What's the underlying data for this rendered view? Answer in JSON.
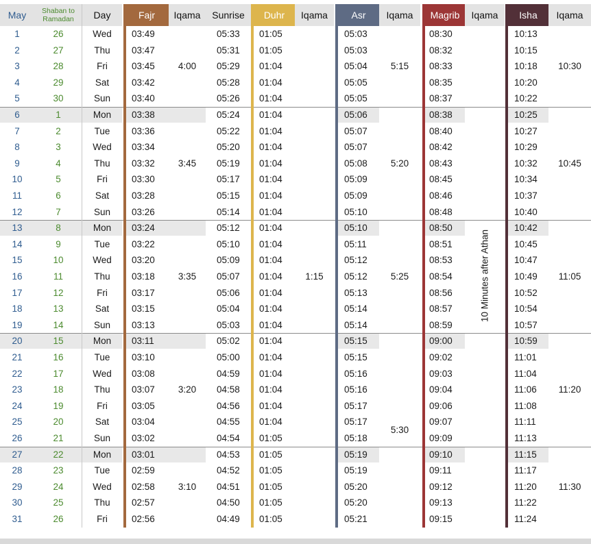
{
  "headers": {
    "date": "May",
    "hijri_line1": "Shaban to",
    "hijri_line2": "Ramadan",
    "day": "Day",
    "fajr": "Fajr",
    "fajr_iqama": "Iqama",
    "sunrise": "Sunrise",
    "duhr": "Duhr",
    "duhr_iqama": "Iqama",
    "asr": "Asr",
    "asr_iqama": "Iqama",
    "magrib": "Magrib",
    "magrib_iqama": "Iqama",
    "isha": "Isha",
    "isha_iqama": "Iqama"
  },
  "colors": {
    "fajr": "#a3693e",
    "duhr": "#ddb54d",
    "asr": "#5e6b84",
    "magrib": "#9c3636",
    "isha": "#523038",
    "date_text": "#2f5c8f",
    "hijri_text": "#4b8a2e",
    "week_shade": "#e8e8e8"
  },
  "rows": [
    {
      "date": "1",
      "hijri": "26",
      "day": "Wed",
      "fajr": "03:49",
      "sunrise": "05:33",
      "duhr": "01:05",
      "asr": "05:03",
      "magrib": "08:30",
      "isha": "10:13"
    },
    {
      "date": "2",
      "hijri": "27",
      "day": "Thu",
      "fajr": "03:47",
      "sunrise": "05:31",
      "duhr": "01:05",
      "asr": "05:03",
      "magrib": "08:32",
      "isha": "10:15"
    },
    {
      "date": "3",
      "hijri": "28",
      "day": "Fri",
      "fajr": "03:45",
      "sunrise": "05:29",
      "duhr": "01:04",
      "asr": "05:04",
      "magrib": "08:33",
      "isha": "10:18"
    },
    {
      "date": "4",
      "hijri": "29",
      "day": "Sat",
      "fajr": "03:42",
      "sunrise": "05:28",
      "duhr": "01:04",
      "asr": "05:05",
      "magrib": "08:35",
      "isha": "10:20"
    },
    {
      "date": "5",
      "hijri": "30",
      "day": "Sun",
      "fajr": "03:40",
      "sunrise": "05:26",
      "duhr": "01:04",
      "asr": "05:05",
      "magrib": "08:37",
      "isha": "10:22"
    },
    {
      "date": "6",
      "hijri": "1",
      "day": "Mon",
      "fajr": "03:38",
      "sunrise": "05:24",
      "duhr": "01:04",
      "asr": "05:06",
      "magrib": "08:38",
      "isha": "10:25"
    },
    {
      "date": "7",
      "hijri": "2",
      "day": "Tue",
      "fajr": "03:36",
      "sunrise": "05:22",
      "duhr": "01:04",
      "asr": "05:07",
      "magrib": "08:40",
      "isha": "10:27"
    },
    {
      "date": "8",
      "hijri": "3",
      "day": "Wed",
      "fajr": "03:34",
      "sunrise": "05:20",
      "duhr": "01:04",
      "asr": "05:07",
      "magrib": "08:42",
      "isha": "10:29"
    },
    {
      "date": "9",
      "hijri": "4",
      "day": "Thu",
      "fajr": "03:32",
      "sunrise": "05:19",
      "duhr": "01:04",
      "asr": "05:08",
      "magrib": "08:43",
      "isha": "10:32"
    },
    {
      "date": "10",
      "hijri": "5",
      "day": "Fri",
      "fajr": "03:30",
      "sunrise": "05:17",
      "duhr": "01:04",
      "asr": "05:09",
      "magrib": "08:45",
      "isha": "10:34"
    },
    {
      "date": "11",
      "hijri": "6",
      "day": "Sat",
      "fajr": "03:28",
      "sunrise": "05:15",
      "duhr": "01:04",
      "asr": "05:09",
      "magrib": "08:46",
      "isha": "10:37"
    },
    {
      "date": "12",
      "hijri": "7",
      "day": "Sun",
      "fajr": "03:26",
      "sunrise": "05:14",
      "duhr": "01:04",
      "asr": "05:10",
      "magrib": "08:48",
      "isha": "10:40"
    },
    {
      "date": "13",
      "hijri": "8",
      "day": "Mon",
      "fajr": "03:24",
      "sunrise": "05:12",
      "duhr": "01:04",
      "asr": "05:10",
      "magrib": "08:50",
      "isha": "10:42"
    },
    {
      "date": "14",
      "hijri": "9",
      "day": "Tue",
      "fajr": "03:22",
      "sunrise": "05:10",
      "duhr": "01:04",
      "asr": "05:11",
      "magrib": "08:51",
      "isha": "10:45"
    },
    {
      "date": "15",
      "hijri": "10",
      "day": "Wed",
      "fajr": "03:20",
      "sunrise": "05:09",
      "duhr": "01:04",
      "asr": "05:12",
      "magrib": "08:53",
      "isha": "10:47"
    },
    {
      "date": "16",
      "hijri": "11",
      "day": "Thu",
      "fajr": "03:18",
      "sunrise": "05:07",
      "duhr": "01:04",
      "asr": "05:12",
      "magrib": "08:54",
      "isha": "10:49"
    },
    {
      "date": "17",
      "hijri": "12",
      "day": "Fri",
      "fajr": "03:17",
      "sunrise": "05:06",
      "duhr": "01:04",
      "asr": "05:13",
      "magrib": "08:56",
      "isha": "10:52"
    },
    {
      "date": "18",
      "hijri": "13",
      "day": "Sat",
      "fajr": "03:15",
      "sunrise": "05:04",
      "duhr": "01:04",
      "asr": "05:14",
      "magrib": "08:57",
      "isha": "10:54"
    },
    {
      "date": "19",
      "hijri": "14",
      "day": "Sun",
      "fajr": "03:13",
      "sunrise": "05:03",
      "duhr": "01:04",
      "asr": "05:14",
      "magrib": "08:59",
      "isha": "10:57"
    },
    {
      "date": "20",
      "hijri": "15",
      "day": "Mon",
      "fajr": "03:11",
      "sunrise": "05:02",
      "duhr": "01:04",
      "asr": "05:15",
      "magrib": "09:00",
      "isha": "10:59"
    },
    {
      "date": "21",
      "hijri": "16",
      "day": "Tue",
      "fajr": "03:10",
      "sunrise": "05:00",
      "duhr": "01:04",
      "asr": "05:15",
      "magrib": "09:02",
      "isha": "11:01"
    },
    {
      "date": "22",
      "hijri": "17",
      "day": "Wed",
      "fajr": "03:08",
      "sunrise": "04:59",
      "duhr": "01:04",
      "asr": "05:16",
      "magrib": "09:03",
      "isha": "11:04"
    },
    {
      "date": "23",
      "hijri": "18",
      "day": "Thu",
      "fajr": "03:07",
      "sunrise": "04:58",
      "duhr": "01:04",
      "asr": "05:16",
      "magrib": "09:04",
      "isha": "11:06"
    },
    {
      "date": "24",
      "hijri": "19",
      "day": "Fri",
      "fajr": "03:05",
      "sunrise": "04:56",
      "duhr": "01:04",
      "asr": "05:17",
      "magrib": "09:06",
      "isha": "11:08"
    },
    {
      "date": "25",
      "hijri": "20",
      "day": "Sat",
      "fajr": "03:04",
      "sunrise": "04:55",
      "duhr": "01:04",
      "asr": "05:17",
      "magrib": "09:07",
      "isha": "11:11"
    },
    {
      "date": "26",
      "hijri": "21",
      "day": "Sun",
      "fajr": "03:02",
      "sunrise": "04:54",
      "duhr": "01:05",
      "asr": "05:18",
      "magrib": "09:09",
      "isha": "11:13"
    },
    {
      "date": "27",
      "hijri": "22",
      "day": "Mon",
      "fajr": "03:01",
      "sunrise": "04:53",
      "duhr": "01:05",
      "asr": "05:19",
      "magrib": "09:10",
      "isha": "11:15"
    },
    {
      "date": "28",
      "hijri": "23",
      "day": "Tue",
      "fajr": "02:59",
      "sunrise": "04:52",
      "duhr": "01:05",
      "asr": "05:19",
      "magrib": "09:11",
      "isha": "11:17"
    },
    {
      "date": "29",
      "hijri": "24",
      "day": "Wed",
      "fajr": "02:58",
      "sunrise": "04:51",
      "duhr": "01:05",
      "asr": "05:20",
      "magrib": "09:12",
      "isha": "11:20"
    },
    {
      "date": "30",
      "hijri": "25",
      "day": "Thu",
      "fajr": "02:57",
      "sunrise": "04:50",
      "duhr": "01:05",
      "asr": "05:20",
      "magrib": "09:13",
      "isha": "11:22"
    },
    {
      "date": "31",
      "hijri": "26",
      "day": "Fri",
      "fajr": "02:56",
      "sunrise": "04:49",
      "duhr": "01:05",
      "asr": "05:21",
      "magrib": "09:15",
      "isha": "11:24"
    }
  ],
  "fajr_iqama": [
    "4:00",
    "3:45",
    "3:35",
    "3:20",
    "3:10"
  ],
  "duhr_iqama": "1:15",
  "asr_iqama": [
    "5:15",
    "5:20",
    "5:25",
    "5:30"
  ],
  "magrib_iqama": "10 Minutes after Athan",
  "isha_iqama": [
    "10:30",
    "10:45",
    "11:05",
    "11:20",
    "11:30"
  ]
}
